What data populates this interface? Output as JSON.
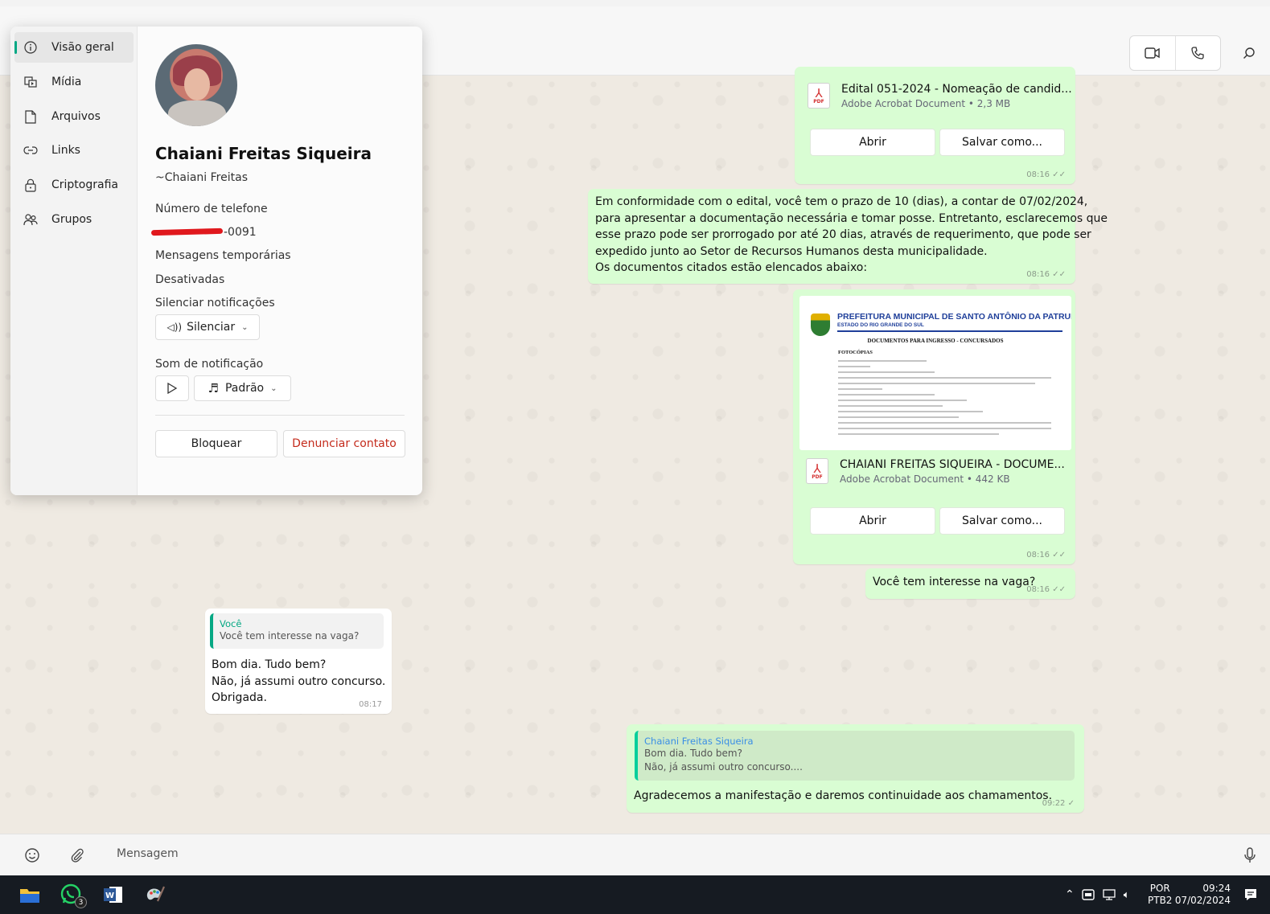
{
  "header": {
    "video_call": "video-camera-icon",
    "voice_call": "phone-icon",
    "search": "search-icon"
  },
  "contact_panel": {
    "nav": [
      {
        "label": "Visão geral",
        "icon": "info-icon"
      },
      {
        "label": "Mídia",
        "icon": "media-icon"
      },
      {
        "label": "Arquivos",
        "icon": "file-icon"
      },
      {
        "label": "Links",
        "icon": "link-icon"
      },
      {
        "label": "Criptografia",
        "icon": "lock-icon"
      },
      {
        "label": "Grupos",
        "icon": "groups-icon"
      }
    ],
    "name": "Chaiani Freitas Siqueira",
    "push_name": "~Chaiani Freitas",
    "phone_label": "Número de telefone",
    "phone_value": "-0091",
    "temp_messages_label": "Mensagens temporárias",
    "temp_messages_value": "Desativadas",
    "mute_label": "Silenciar notificações",
    "mute_button": "Silenciar",
    "sound_label": "Som de notificação",
    "sound_value": "Padrão",
    "block_button": "Bloquear",
    "report_button": "Denunciar contato"
  },
  "messages": {
    "doc1": {
      "name": "Edital 051-2024 - Nomeação de candid...",
      "meta": "Adobe Acrobat Document • 2,3 MB",
      "open": "Abrir",
      "save": "Salvar como...",
      "time": "08:16"
    },
    "text1": {
      "lines": [
        "Em conformidade com o edital, você tem o prazo de 10 (dias), a contar de 07/02/2024,",
        "para apresentar a documentação necessária e tomar posse. Entretanto, esclarecemos que",
        "esse prazo pode ser prorrogado por até 20 dias, através de requerimento, que pode ser",
        "expedido junto ao Setor de Recursos Humanos desta municipalidade.",
        "Os documentos citados estão elencados abaixo:"
      ],
      "time": "08:16"
    },
    "doc2": {
      "preview_title": "PREFEITURA MUNICIPAL DE SANTO ANTÔNIO DA PATRULHA",
      "preview_subtitle": "ESTADO DO RIO GRANDE DO SUL",
      "preview_heading": "DOCUMENTOS PARA INGRESSO - CONCURSADOS",
      "preview_section": "FOTOCÓPIAS",
      "name": "CHAIANI FREITAS SIQUEIRA - DOCUME...",
      "meta": "Adobe Acrobat Document • 442 KB",
      "open": "Abrir",
      "save": "Salvar como...",
      "time": "08:16"
    },
    "text2": {
      "text": "Você tem interesse na vaga?",
      "time": "08:16"
    },
    "reply_in": {
      "quote_author": "Você",
      "quote_text": "Você tem interesse na vaga?",
      "lines": [
        "Bom dia. Tudo bem?",
        "Não, já assumi outro concurso.",
        "Obrigada."
      ],
      "time": "08:17"
    },
    "reply_out": {
      "quote_author": "Chaiani Freitas Siqueira",
      "quote_lines": [
        "Bom dia. Tudo bem?",
        "Não, já assumi outro concurso...."
      ],
      "text": "Agradecemos a manifestação e daremos continuidade aos chamamentos.",
      "time": "09:22"
    }
  },
  "composer": {
    "placeholder": "Mensagem",
    "emoji": "emoji-icon",
    "attach": "paperclip-icon",
    "mic": "microphone-icon"
  },
  "taskbar": {
    "whatsapp_badge": "3",
    "lang_top": "POR",
    "lang_bottom": "PTB2",
    "clock_time": "09:24",
    "clock_date": "07/02/2024"
  },
  "colors": {
    "accent": "#00a884",
    "outgoing": "#d9fdd3",
    "report": "#c42b1c"
  }
}
